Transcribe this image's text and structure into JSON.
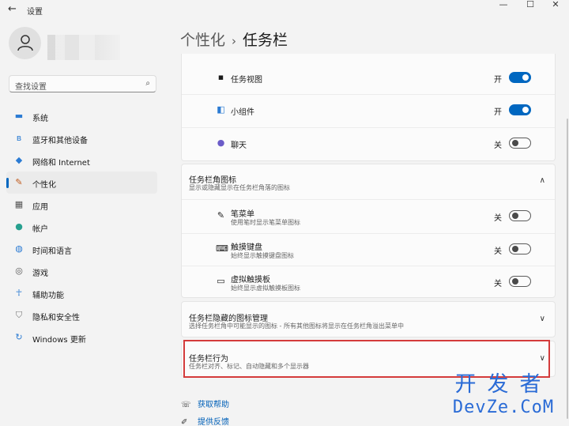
{
  "window": {
    "title": "设置",
    "back": "←",
    "minimize": "—",
    "maximize": "☐",
    "close": "✕"
  },
  "search": {
    "placeholder": "查找设置",
    "icon": "search-icon"
  },
  "sidebar": {
    "items": [
      {
        "label": "系统",
        "icon": "monitor-icon"
      },
      {
        "label": "蓝牙和其他设备",
        "icon": "bluetooth-icon"
      },
      {
        "label": "网络和 Internet",
        "icon": "wifi-icon"
      },
      {
        "label": "个性化",
        "icon": "brush-icon",
        "active": true
      },
      {
        "label": "应用",
        "icon": "apps-icon"
      },
      {
        "label": "帐户",
        "icon": "account-icon"
      },
      {
        "label": "时间和语言",
        "icon": "globe-clock-icon"
      },
      {
        "label": "游戏",
        "icon": "gamepad-icon"
      },
      {
        "label": "辅助功能",
        "icon": "accessibility-icon"
      },
      {
        "label": "隐私和安全性",
        "icon": "shield-icon"
      },
      {
        "label": "Windows 更新",
        "icon": "update-icon"
      }
    ]
  },
  "breadcrumb": {
    "parent": "个性化",
    "separator": "›",
    "current": "任务栏"
  },
  "taskbar_items": [
    {
      "label": "任务视图",
      "state": "开",
      "on": true,
      "icon": "task-view-icon"
    },
    {
      "label": "小组件",
      "state": "开",
      "on": true,
      "icon": "widgets-icon"
    },
    {
      "label": "聊天",
      "state": "关",
      "on": false,
      "icon": "chat-icon"
    }
  ],
  "corner_icons": {
    "title": "任务栏角图标",
    "subtitle": "显示或隐藏显示在任务栏角落的图标",
    "items": [
      {
        "label": "笔菜单",
        "sub": "使用笔时显示笔菜单图标",
        "state": "关",
        "on": false,
        "icon": "pen-icon"
      },
      {
        "label": "触摸键盘",
        "sub": "始终显示触摸键盘图标",
        "state": "关",
        "on": false,
        "icon": "keyboard-icon"
      },
      {
        "label": "虚拟触摸板",
        "sub": "始终显示虚拟触摸板图标",
        "state": "关",
        "on": false,
        "icon": "touchpad-icon"
      }
    ]
  },
  "overflow": {
    "title": "任务栏隐藏的图标管理",
    "subtitle": "选择任务栏角中可能显示的图标 - 所有其他图标将显示在任务栏角溢出菜单中"
  },
  "behaviors": {
    "title": "任务栏行为",
    "subtitle": "任务栏对齐、标记、自动隐藏和多个显示器"
  },
  "links": [
    {
      "label": "获取帮助",
      "icon": "help-icon"
    },
    {
      "label": "提供反馈",
      "icon": "feedback-icon"
    }
  ],
  "watermark": {
    "cn": "开发者",
    "en": "DevZe.CoM"
  },
  "colors": {
    "accent": "#0067c0",
    "highlight": "#d43b3b",
    "watermark": "#2a6bd6"
  }
}
